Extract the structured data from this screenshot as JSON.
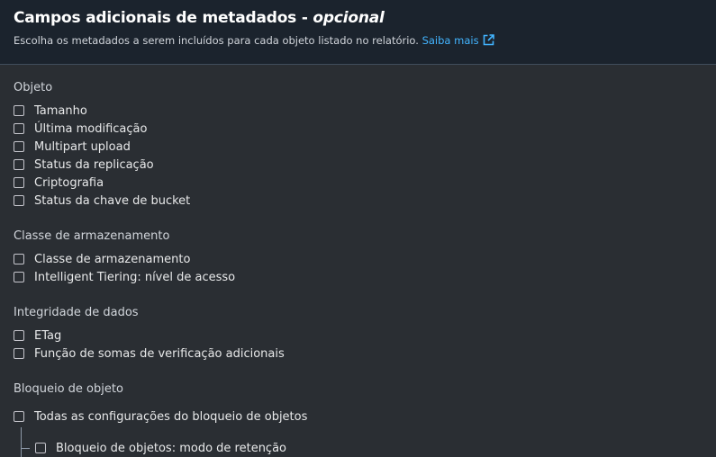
{
  "header": {
    "title": "Campos adicionais de metadados",
    "title_sep": " - ",
    "title_optional": "opcional",
    "subtitle": "Escolha os metadados a serem incluídos para cada objeto listado no relatório.",
    "learn_more": "Saiba mais",
    "learn_more_icon": "external-link-icon"
  },
  "groups": {
    "objeto": {
      "title": "Objeto",
      "items": [
        "Tamanho",
        "Última modificação",
        "Multipart upload",
        "Status da replicação",
        "Criptografia",
        "Status da chave de bucket"
      ]
    },
    "armazenamento": {
      "title": "Classe de armazenamento",
      "items": [
        "Classe de armazenamento",
        "Intelligent Tiering: nível de acesso"
      ]
    },
    "integridade": {
      "title": "Integridade de dados",
      "items": [
        "ETag",
        "Função de somas de verificação adicionais"
      ]
    },
    "bloqueio": {
      "title": "Bloqueio de objeto",
      "items": [
        "Todas as configurações do bloqueio de objetos"
      ],
      "sub_items": [
        "Bloqueio de objetos: modo de retenção"
      ]
    }
  },
  "colors": {
    "header_bg": "#1b232d",
    "body_bg": "#2a2e33",
    "link": "#42b4ff"
  }
}
